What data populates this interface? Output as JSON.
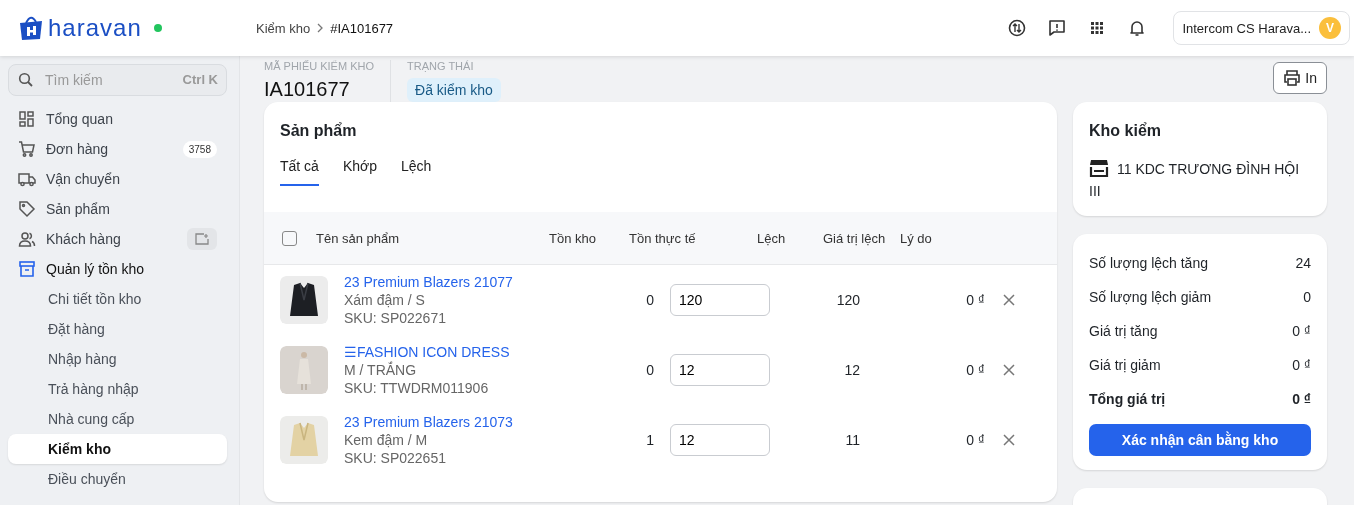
{
  "header": {
    "logo_text": "haravan",
    "online": true,
    "breadcrumb": [
      "Kiểm kho",
      "#IA101677"
    ],
    "account": {
      "name": "Intercom CS Harava...",
      "initial": "V"
    }
  },
  "sidebar": {
    "search": {
      "placeholder": "Tìm kiếm",
      "shortcut": "Ctrl K"
    },
    "items": [
      {
        "label": "Tổng quan",
        "expanded": false
      },
      {
        "label": "Đơn hàng",
        "expanded": false,
        "badge": "3758"
      },
      {
        "label": "Vận chuyển",
        "expanded": false
      },
      {
        "label": "Sản phẩm",
        "expanded": false
      },
      {
        "label": "Khách hàng",
        "expanded": false,
        "action": true
      },
      {
        "label": "Quản lý tồn kho",
        "expanded": true,
        "children": [
          {
            "label": "Chi tiết tồn kho",
            "selected": false
          },
          {
            "label": "Đặt hàng",
            "selected": false
          },
          {
            "label": "Nhập hàng",
            "selected": false
          },
          {
            "label": "Trả hàng nhập",
            "selected": false
          },
          {
            "label": "Nhà cung cấp",
            "selected": false
          },
          {
            "label": "Kiểm kho",
            "selected": true
          },
          {
            "label": "Điều chuyển",
            "selected": false
          }
        ]
      }
    ]
  },
  "summary": {
    "code_label": "MÃ PHIẾU KIỂM KHO",
    "code": "IA101677",
    "status_label": "TRẠNG THÁI",
    "status": "Đã kiểm kho",
    "print_button": "In"
  },
  "products": {
    "title": "Sản phẩm",
    "tabs": [
      {
        "label": "Tất cả",
        "selected": true
      },
      {
        "label": "Khớp",
        "selected": false
      },
      {
        "label": "Lệch",
        "selected": false
      }
    ],
    "select_all": {
      "checked": false
    },
    "columns": [
      "Tên sản phẩm",
      "Tồn kho",
      "Tồn thực tế",
      "Lệch",
      "Giá trị lệch",
      "Lý do"
    ],
    "rows": [
      {
        "name": "23 Premium Blazers 21077",
        "variant": "Xám đậm / S",
        "sku": "SKU: SP022671",
        "stock": "0",
        "actual": "120",
        "diff": "120",
        "value": "0 ₫"
      },
      {
        "name": "☰FASHION ICON DRESS",
        "variant": "M / TRẮNG",
        "sku": "SKU: TTWDRM011906",
        "stock": "0",
        "actual": "12",
        "diff": "12",
        "value": "0 ₫"
      },
      {
        "name": "23 Premium Blazers 21073",
        "variant": "Kem đậm / M",
        "sku": "SKU: SP022651",
        "stock": "1",
        "actual": "12",
        "diff": "11",
        "value": "0 ₫"
      }
    ]
  },
  "warehouse": {
    "title": "Kho kiểm",
    "name": "11 KDC TRƯƠNG ĐÌNH HỘI III"
  },
  "totals": {
    "rows": [
      {
        "label": "Số lượng lệch tăng",
        "value": "24",
        "bold": false
      },
      {
        "label": "Số lượng lệch giảm",
        "value": "0",
        "bold": false
      },
      {
        "label": "Giá trị tăng",
        "value": "0 ₫",
        "bold": false
      },
      {
        "label": "Giá trị giảm",
        "value": "0 ₫",
        "bold": false
      },
      {
        "label": "Tổng giá trị",
        "value": "0 ₫",
        "bold": true
      }
    ],
    "confirm_button": "Xác nhận cân bằng kho"
  }
}
